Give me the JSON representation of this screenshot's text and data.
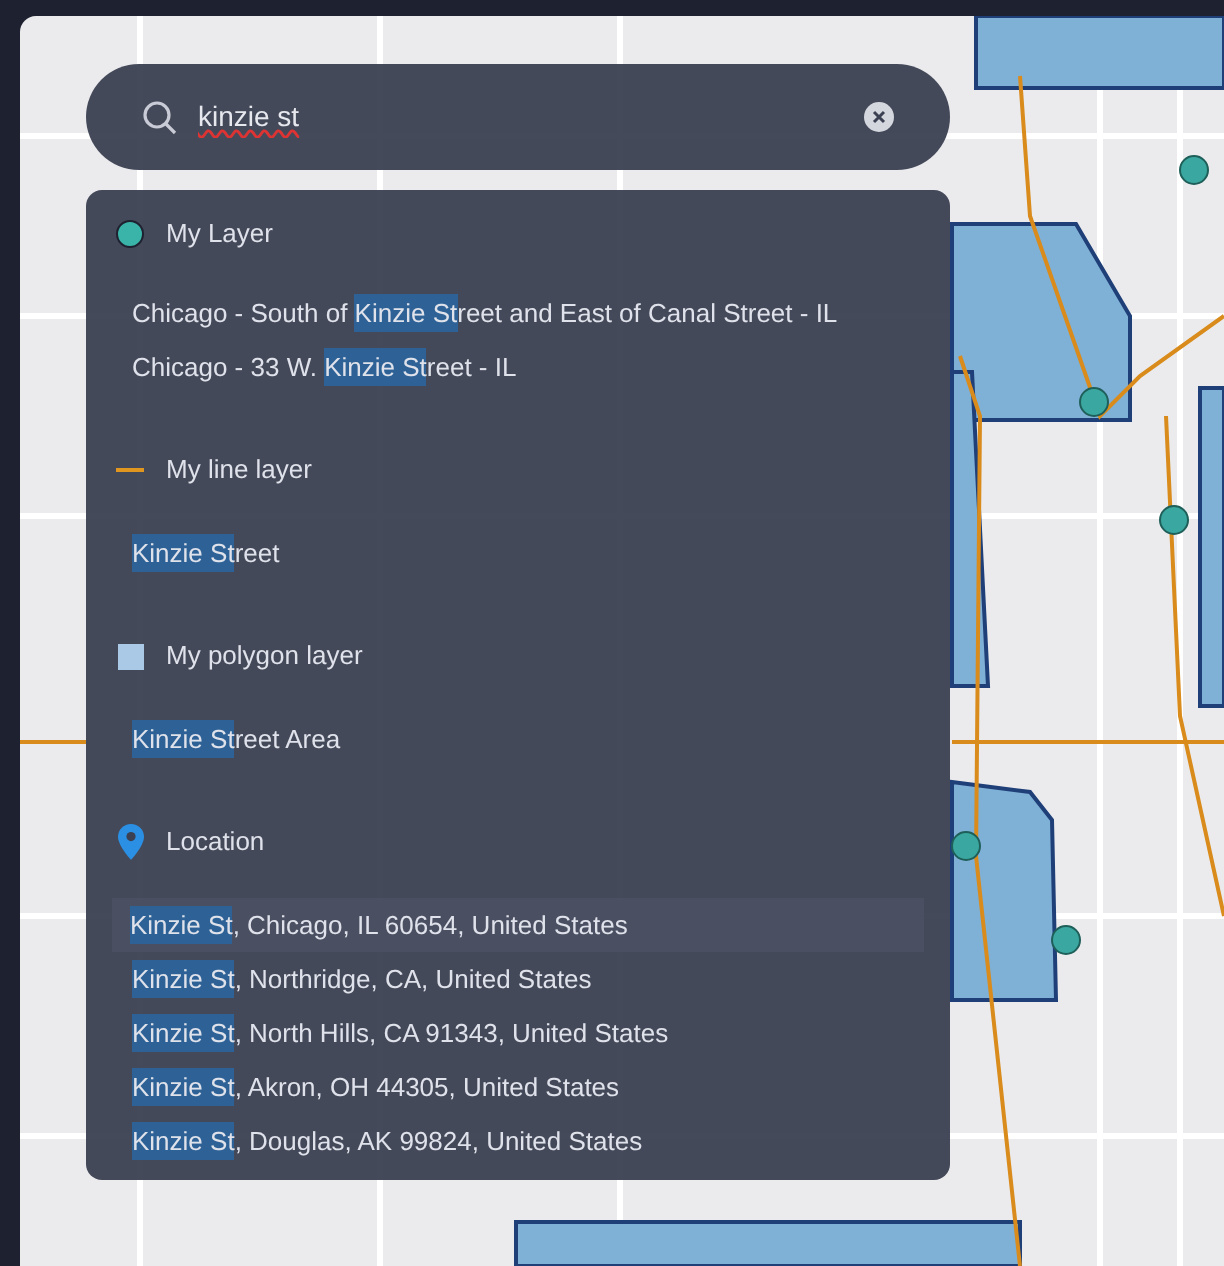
{
  "search": {
    "value": "kinzie st"
  },
  "groups": [
    {
      "kind": "point",
      "title": "My Layer",
      "results": [
        {
          "selected": false,
          "parts": [
            {
              "text": "Chicago - South of ",
              "highlight": false
            },
            {
              "text": "Kinzie St",
              "highlight": true
            },
            {
              "text": "reet and East of Canal Street - IL",
              "highlight": false
            }
          ]
        },
        {
          "selected": false,
          "parts": [
            {
              "text": "Chicago - 33 W. ",
              "highlight": false
            },
            {
              "text": "Kinzie St",
              "highlight": true
            },
            {
              "text": "reet - IL",
              "highlight": false
            }
          ]
        }
      ]
    },
    {
      "kind": "line",
      "title": "My line layer",
      "results": [
        {
          "selected": false,
          "parts": [
            {
              "text": "Kinzie St",
              "highlight": true
            },
            {
              "text": "reet",
              "highlight": false
            }
          ]
        }
      ]
    },
    {
      "kind": "polygon",
      "title": "My polygon layer",
      "results": [
        {
          "selected": false,
          "parts": [
            {
              "text": "Kinzie St",
              "highlight": true
            },
            {
              "text": "reet Area",
              "highlight": false
            }
          ]
        }
      ]
    },
    {
      "kind": "location",
      "title": "Location",
      "results": [
        {
          "selected": true,
          "parts": [
            {
              "text": "Kinzie St",
              "highlight": true
            },
            {
              "text": ", Chicago, IL 60654, United States",
              "highlight": false
            }
          ]
        },
        {
          "selected": false,
          "parts": [
            {
              "text": "Kinzie St",
              "highlight": true
            },
            {
              "text": ", Northridge, CA, United States",
              "highlight": false
            }
          ]
        },
        {
          "selected": false,
          "parts": [
            {
              "text": "Kinzie St",
              "highlight": true
            },
            {
              "text": ", North Hills, CA 91343, United States",
              "highlight": false
            }
          ]
        },
        {
          "selected": false,
          "parts": [
            {
              "text": "Kinzie St",
              "highlight": true
            },
            {
              "text": ", Akron, OH 44305, United States",
              "highlight": false
            }
          ]
        },
        {
          "selected": false,
          "parts": [
            {
              "text": "Kinzie St",
              "highlight": true
            },
            {
              "text": ", Douglas, AK 99824, United States",
              "highlight": false
            }
          ]
        }
      ]
    }
  ]
}
